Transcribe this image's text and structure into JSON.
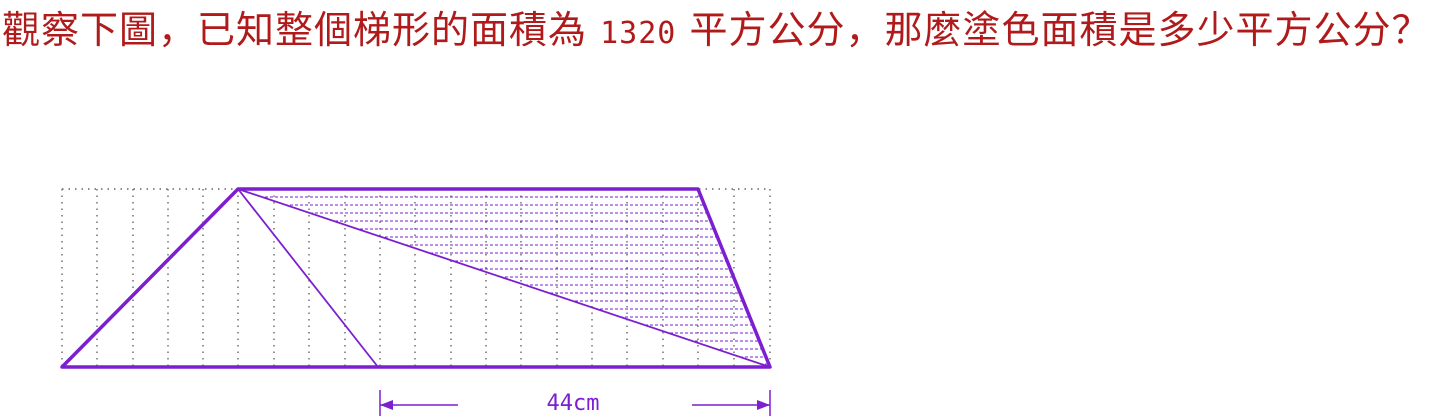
{
  "question": {
    "part1": "觀察下圖，已知整個梯形的面積為",
    "area_value": "1320",
    "part2": "平方公分，那麼塗色面積是多少平方公分？"
  },
  "figure": {
    "dimension_label": "44cm",
    "colors": {
      "outline": "#7b1fd0",
      "hatch": "#7b1fd0",
      "grid": "#666666",
      "question_text": "#b01a1a"
    }
  }
}
